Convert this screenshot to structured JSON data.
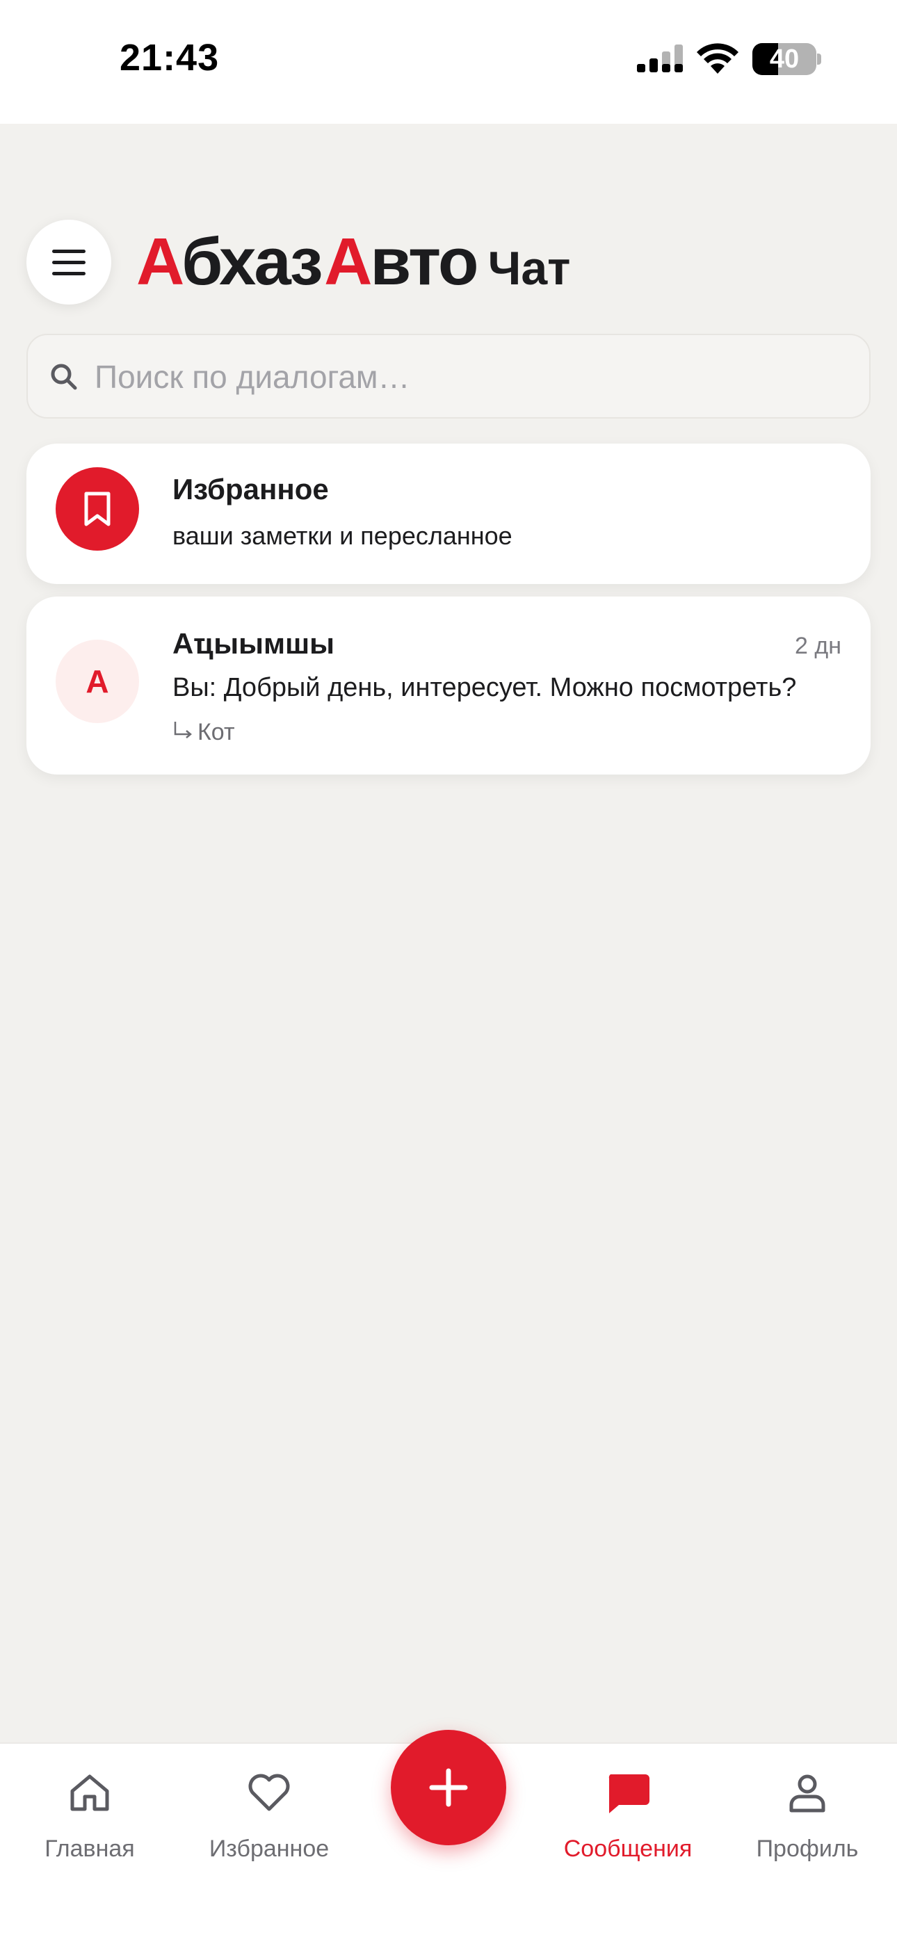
{
  "status_bar": {
    "time": "21:43",
    "battery_level": 40,
    "battery_text": "40"
  },
  "header": {
    "logo_first_letter": "А",
    "logo_first_rest": "бхаз",
    "logo_second_letter": "А",
    "logo_second_rest": "вто",
    "logo_suffix": "Чат",
    "accent_color": "#e11b2b"
  },
  "search": {
    "placeholder": "Поиск по диалогам…",
    "value": ""
  },
  "dialogs": [
    {
      "title": "Избранное",
      "subtitle": "ваши заметки и пересланное",
      "icon": "bookmark-icon"
    },
    {
      "avatar_letter": "A",
      "title": "Аҵыымшы",
      "time": "2 дн",
      "last_message": "Вы: Добрый день, интересует. Можно посмотреть?",
      "reply_to": "Кот"
    }
  ],
  "tab_bar": {
    "tabs": [
      {
        "label": "Главная",
        "icon": "home-icon",
        "active": false
      },
      {
        "label": "Избранное",
        "icon": "heart-icon",
        "active": false
      },
      {
        "label": "Сообщения",
        "icon": "chat-bubble-icon",
        "active": true
      },
      {
        "label": "Профиль",
        "icon": "person-icon",
        "active": false
      }
    ],
    "fab_icon": "plus-icon"
  }
}
